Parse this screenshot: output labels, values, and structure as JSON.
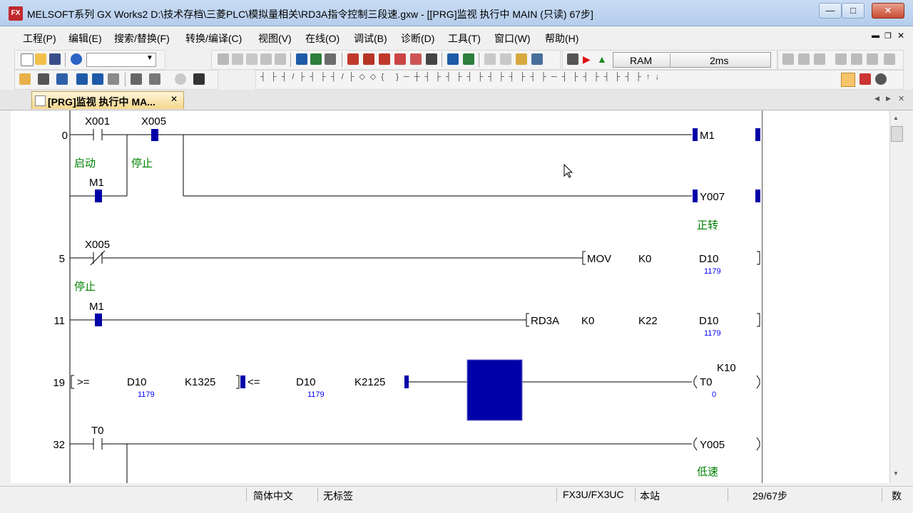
{
  "window": {
    "app_icon_text": "FX",
    "title": "MELSOFT系列 GX Works2 D:\\技术存档\\三菱PLC\\模拟量相关\\RD3A指令控制三段速.gxw - [[PRG]监视 执行中 MAIN (只读) 67步]",
    "minimize": "—",
    "maximize": "□",
    "close": "✕"
  },
  "menu": [
    "工程(P)",
    "编辑(E)",
    "搜索/替换(F)",
    "转换/编译(C)",
    "视图(V)",
    "在线(O)",
    "调试(B)",
    "诊断(D)",
    "工具(T)",
    "窗口(W)",
    "帮助(H)"
  ],
  "toolbar": {
    "status_ram": "RAM",
    "status_scan": "2ms"
  },
  "tab": {
    "label": "[PRG]监视 执行中 MA...",
    "close": "✕",
    "nav_left": "◀",
    "nav_right": "▶"
  },
  "ladder": {
    "steps": [
      "0",
      "5",
      "11",
      "19",
      "32"
    ],
    "rung0": {
      "contact1": "X001",
      "contact1_comment": "启动",
      "contact2": "X005",
      "contact2_comment": "停止",
      "branch": "M1",
      "coil1": "M1",
      "coil2": "Y007",
      "coil2_comment": "正转"
    },
    "rung5": {
      "contact": "X005",
      "contact_comment": "停止",
      "inst": "MOV",
      "op1": "K0",
      "op2": "D10",
      "op2_value": "1179"
    },
    "rung11": {
      "contact": "M1",
      "inst": "RD3A",
      "op1": "K0",
      "op2": "K22",
      "op3": "D10",
      "op3_value": "1179"
    },
    "rung19": {
      "cmp1_op": ">=",
      "cmp1_a": "D10",
      "cmp1_a_value": "1179",
      "cmp1_b": "K1325",
      "cmp2_op": "<=",
      "cmp2_a": "D10",
      "cmp2_a_value": "1179",
      "cmp2_b": "K2125",
      "timer": "T0",
      "timer_set": "K10",
      "timer_value": "0"
    },
    "rung32": {
      "contact": "T0",
      "coil": "Y005",
      "coil_comment": "低速"
    }
  },
  "status": {
    "language": "简体中文",
    "label": "无标签",
    "cpu": "FX3U/FX3UC",
    "station": "本站",
    "step": "29/67步",
    "numlock": "数"
  },
  "colors": {
    "monitor_on": "#0000a8",
    "ladder_line": "#000000",
    "comment_green": "#008000",
    "value_blue": "#0000ff"
  }
}
